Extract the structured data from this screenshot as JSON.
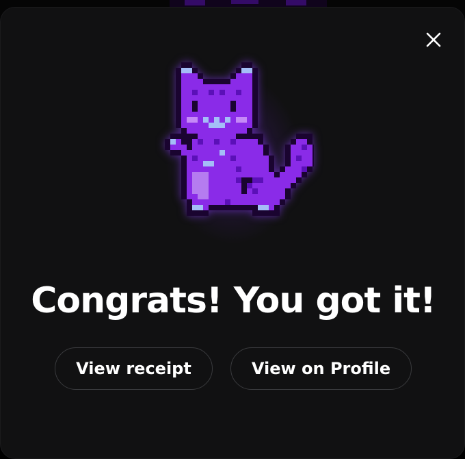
{
  "modal": {
    "headline": "Congrats! You got it!",
    "close_icon": "close-icon",
    "artwork": {
      "icon": "pixel-cat-nft-icon",
      "colors": {
        "outline": "#1a0430",
        "body": "#8a2be8",
        "body_dark": "#5b10b8",
        "highlight": "#a4bef7",
        "cheek": "#c58af7",
        "belly": "#b57cf0",
        "glow": "#7a28e6"
      }
    },
    "actions": [
      {
        "label": "View receipt"
      },
      {
        "label": "View on Profile"
      }
    ]
  },
  "theme": {
    "background": "#111112",
    "text": "#ffffff",
    "button_border": "#3a3b3e"
  }
}
